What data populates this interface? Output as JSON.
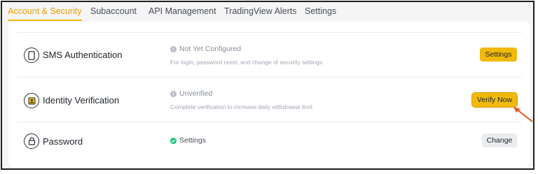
{
  "tabs": [
    {
      "label": "Account & Security",
      "active": true
    },
    {
      "label": "Subaccount",
      "active": false
    },
    {
      "label": "API Management",
      "active": false
    },
    {
      "label": "TradingView Alerts",
      "active": false
    },
    {
      "label": "Settings",
      "active": false
    }
  ],
  "security_rows": [
    {
      "title": "SMS Authentication",
      "icon": "phone-icon",
      "status": "Not Yet Configured",
      "status_icon": "info-dot-icon",
      "description": "For login, password reset, and change of security settings",
      "action_label": "Settings",
      "action_style": "primary"
    },
    {
      "title": "Identity Verification",
      "icon": "id-card-icon",
      "status": "Unverified",
      "status_icon": "info-dot-icon",
      "description": "Complete verification to increase daily withdrawal limit",
      "action_label": "Verify Now",
      "action_style": "primary"
    },
    {
      "title": "Password",
      "icon": "lock-icon",
      "status": "Settings",
      "status_icon": "check-circle-icon",
      "description": "",
      "action_label": "Change",
      "action_style": "secondary"
    }
  ],
  "colors": {
    "accent": "#f0b90b",
    "active_tab_text": "#f0a000",
    "success": "#0ecb81",
    "annotation_arrow": "#e8531f"
  }
}
